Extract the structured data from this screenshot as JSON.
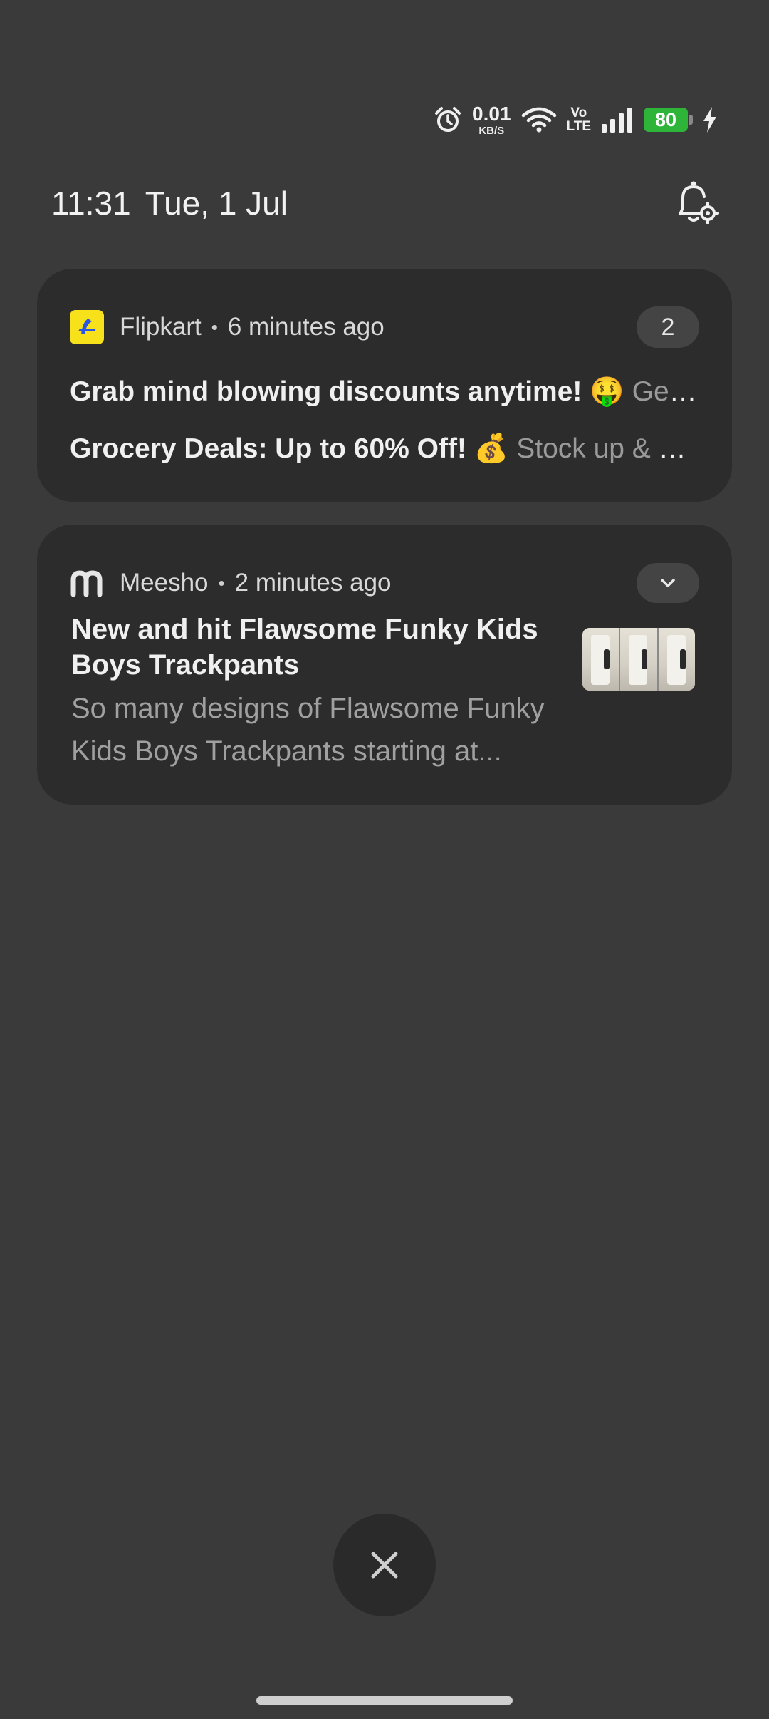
{
  "status_bar": {
    "net_speed_value": "0.01",
    "net_speed_unit": "KB/S",
    "volte_top": "Vo",
    "volte_bottom": "LTE",
    "battery_level": "80",
    "icons": [
      "alarm-icon",
      "wifi-icon",
      "signal-icon",
      "battery-icon",
      "charging-icon"
    ]
  },
  "header": {
    "time": "11:31",
    "date": "Tue, 1 Jul",
    "settings_icon": "bell-settings-icon"
  },
  "notifications": [
    {
      "app": "Flipkart",
      "time": "6 minutes ago",
      "count": "2",
      "lines": [
        {
          "title": "Grab mind blowing discounts anytime! 🤑",
          "text": "Get..."
        },
        {
          "title": "Grocery Deals: Up to 60% Off! 💰",
          "text": "Stock up & save..."
        }
      ]
    },
    {
      "app": "Meesho",
      "time": "2 minutes ago",
      "title": "New and hit Flawsome Funky Kids Boys Trackpants",
      "body": "So many designs of Flawsome Funky Kids Boys Trackpants starting at..."
    }
  ],
  "controls": {
    "clear_all_icon": "close-icon"
  },
  "colors": {
    "background": "#3a3a3a",
    "card": "#2c2c2c",
    "battery": "#2fb43a",
    "flipkart_icon": "#f7e11a"
  }
}
